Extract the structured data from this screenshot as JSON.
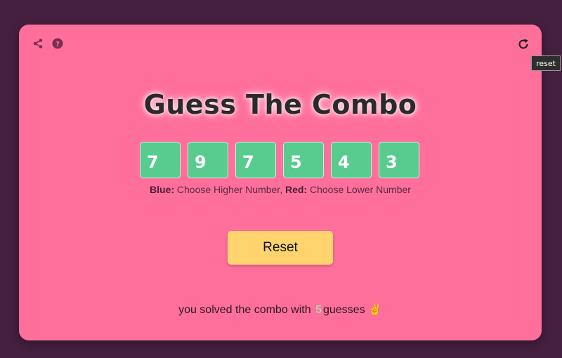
{
  "header": {
    "share_icon": "share-icon",
    "help_icon": "help-icon",
    "reset_icon": "refresh-icon",
    "reset_tooltip": "reset"
  },
  "title": "Guess The Combo",
  "digits": [
    "7",
    "9",
    "7",
    "5",
    "4",
    "3"
  ],
  "hint": {
    "blue_label": "Blue:",
    "blue_text": " Choose Higher Number, ",
    "red_label": "Red:",
    "red_text": " Choose Lower Number"
  },
  "reset_button": "Reset",
  "status": {
    "prefix": "you solved the combo with ",
    "count": "5",
    "suffix": "guesses ",
    "emoji": "✌"
  },
  "colors": {
    "background": "#462040",
    "card": "#ff6f9c",
    "digit_box": "#57cc8e",
    "button": "#ffd46e"
  }
}
